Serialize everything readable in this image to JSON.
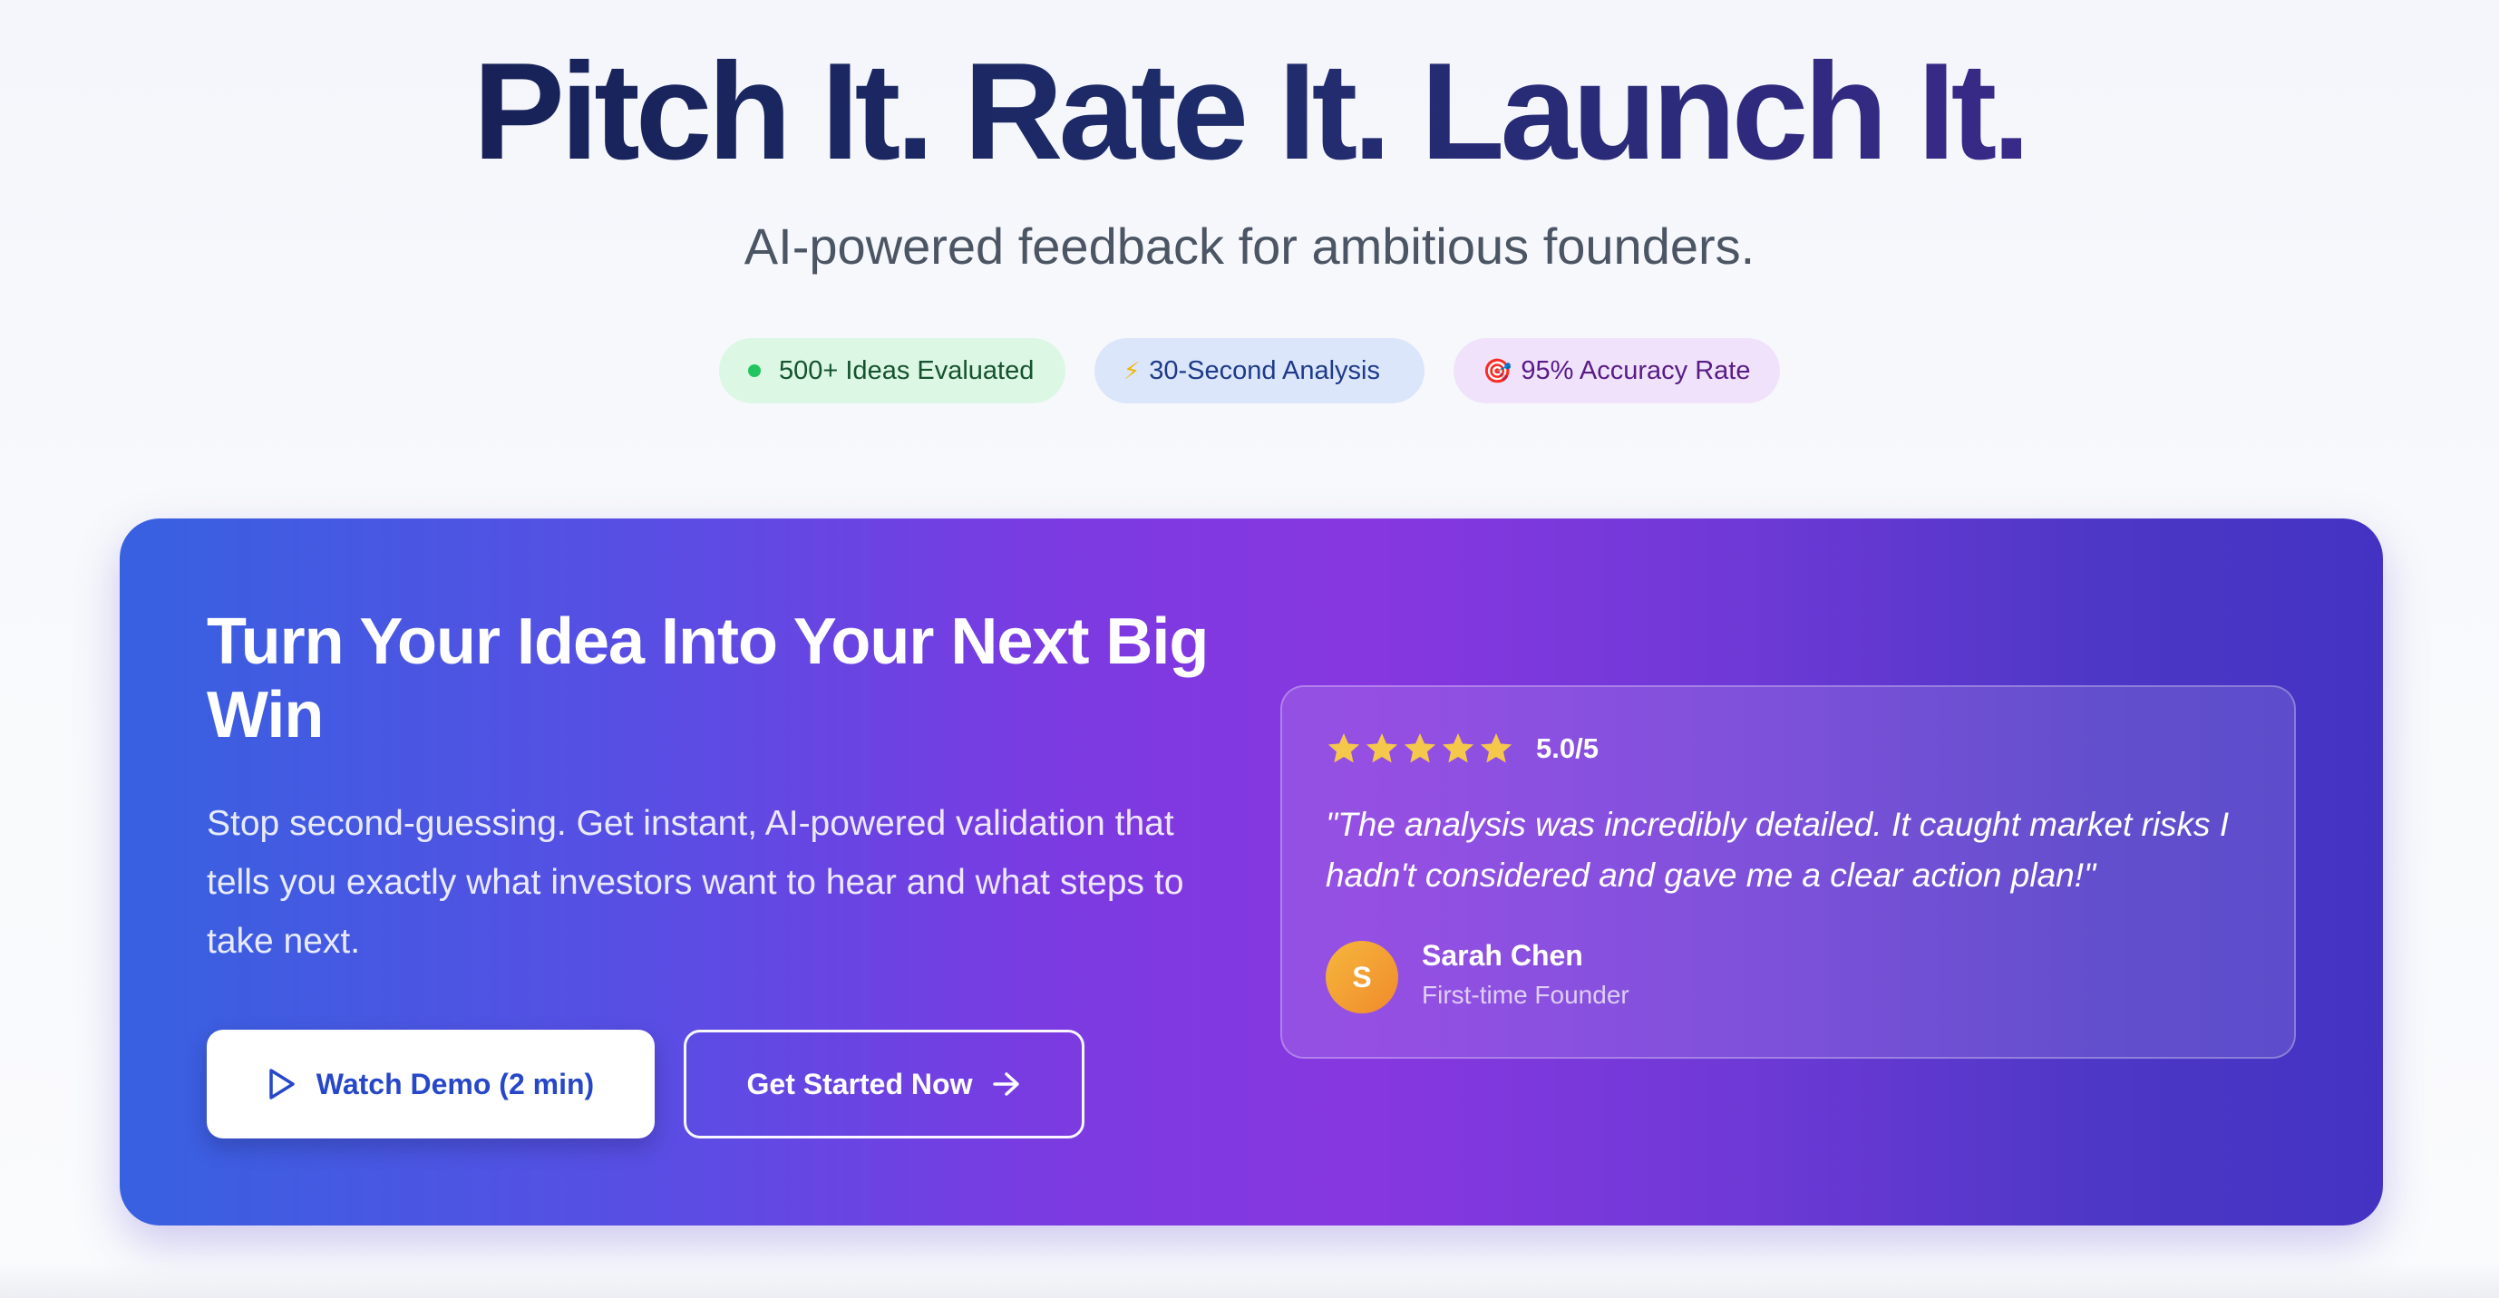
{
  "hero": {
    "title": "Pitch It. Rate It. Launch It.",
    "subtitle": "AI-powered feedback for ambitious founders."
  },
  "stats": [
    {
      "icon": "green-dot-icon",
      "glyph": "",
      "label": "500+ Ideas Evaluated"
    },
    {
      "icon": "lightning-icon",
      "glyph": "⚡",
      "label": "30-Second Analysis"
    },
    {
      "icon": "target-icon",
      "glyph": "🎯",
      "label": "95% Accuracy Rate"
    }
  ],
  "cta": {
    "heading": "Turn Your Idea Into Your Next Big Win",
    "body": "Stop second-guessing. Get instant, AI-powered validation that tells you exactly what investors want to hear and what steps to take next.",
    "demo_button": "Watch Demo (2 min)",
    "start_button": "Get Started Now"
  },
  "testimonial": {
    "stars": 5,
    "rating": "5.0/5",
    "quote": "\"The analysis was incredibly detailed. It caught market risks I hadn't considered and gave me a clear action plan!\"",
    "avatar_initial": "S",
    "name": "Sarah Chen",
    "role": "First-time Founder"
  },
  "colors": {
    "accent": "#4433c3",
    "star": "#f5c84c",
    "primary_button_text": "#2747c9"
  }
}
